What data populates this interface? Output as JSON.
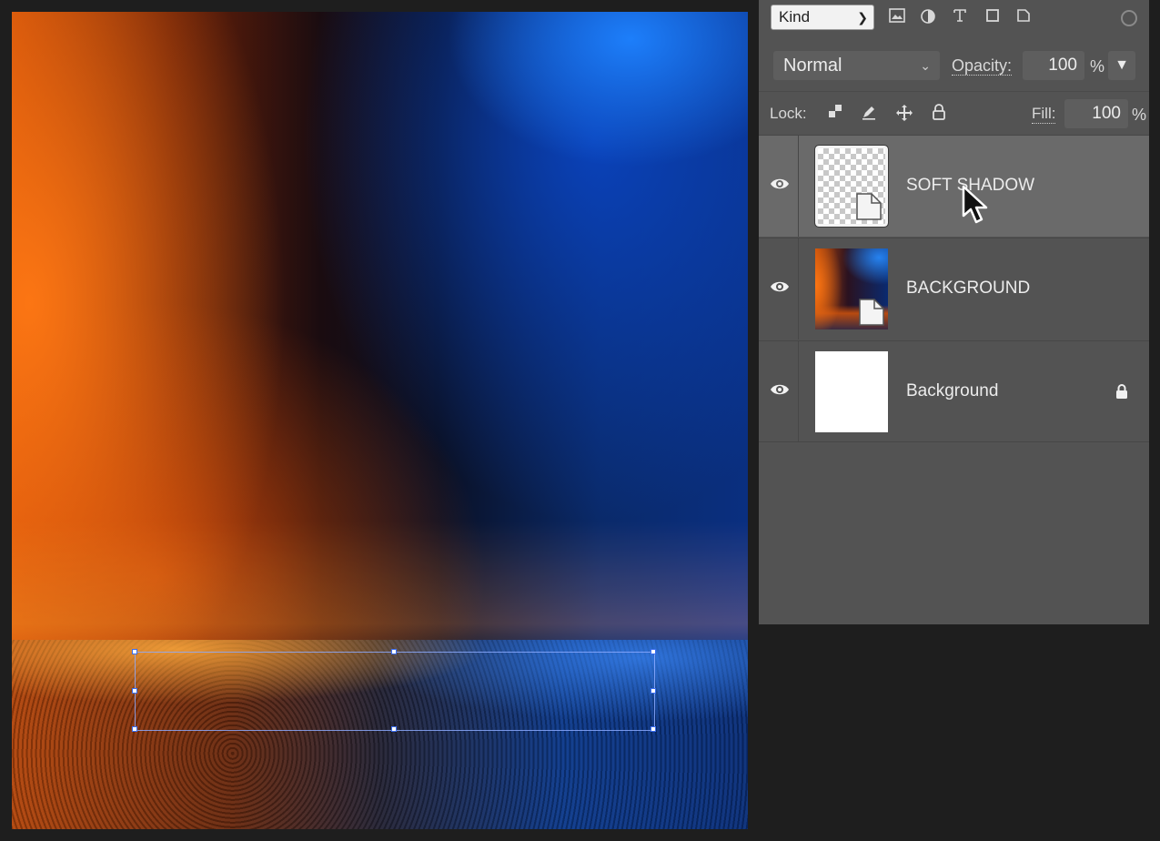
{
  "toolbar": {
    "kind_label": "Kind",
    "filter_icons": [
      "image-filter-icon",
      "adjustment-filter-icon",
      "type-filter-icon",
      "shape-filter-icon",
      "smart-object-filter-icon"
    ]
  },
  "blend": {
    "mode": "Normal",
    "opacity_label": "Opacity:",
    "opacity_value": "100",
    "percent": "%"
  },
  "lock": {
    "label": "Lock:",
    "fill_label": "Fill:",
    "fill_value": "100",
    "percent": "%"
  },
  "layers": [
    {
      "name": "SOFT SHADOW",
      "selected": true,
      "visible": true,
      "thumbnail": "transparent",
      "smart_object": true,
      "locked": false
    },
    {
      "name": "BACKGROUND",
      "selected": false,
      "visible": true,
      "thumbnail": "photo",
      "smart_object": true,
      "locked": false
    },
    {
      "name": "Background",
      "selected": false,
      "visible": true,
      "thumbnail": "white",
      "smart_object": false,
      "locked": true
    }
  ],
  "colors": {
    "panel_bg": "#535353",
    "selected_row": "#6a6a6a",
    "selection_outline": "#8caaff"
  }
}
